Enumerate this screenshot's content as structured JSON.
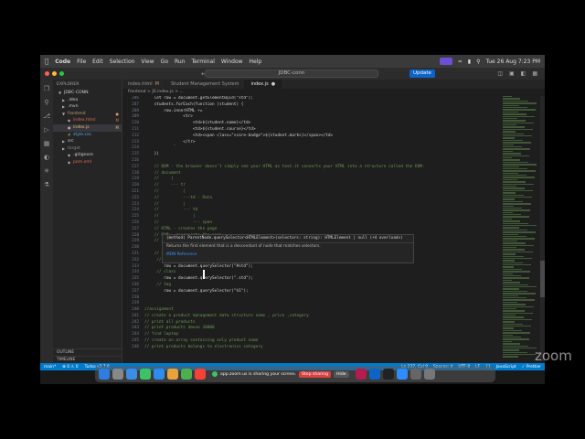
{
  "menubar": {
    "apple": "",
    "items": [
      "Code",
      "File",
      "Edit",
      "Selection",
      "View",
      "Go",
      "Run",
      "Terminal",
      "Window",
      "Help"
    ],
    "datetime": "Tue 26 Aug 7:23 PM"
  },
  "titlebar": {
    "search": "JDBC-conn",
    "update_label": "Update"
  },
  "explorer": {
    "title": "EXPLORER",
    "root": "JDBC-CONN",
    "items": [
      {
        "label": ".idea",
        "mark": ""
      },
      {
        "label": ".mvn",
        "mark": ""
      },
      {
        "label": "frontend",
        "mark": "●"
      },
      {
        "label": "index.html",
        "mark": "M"
      },
      {
        "label": "index.js",
        "mark": "M"
      },
      {
        "label": "style.css",
        "mark": ""
      },
      {
        "label": "src",
        "mark": ""
      },
      {
        "label": "target",
        "mark": ""
      },
      {
        "label": ".gitignore",
        "mark": ""
      },
      {
        "label": "pom.xml",
        "mark": ""
      }
    ],
    "outline": "OUTLINE",
    "timeline": "TIMELINE"
  },
  "tabs": [
    {
      "label": "index.html",
      "mark": "M"
    },
    {
      "label": "Student Management System",
      "mark": ""
    },
    {
      "label": "index.js",
      "mark": "●"
    }
  ],
  "breadcrumb": "frontend > JS index.js > ...",
  "code": [
    {
      "n": "206",
      "t": "    let row = document.getElementById(\"std\");",
      "c": false
    },
    {
      "n": "207",
      "t": "    students.forEach(function (student) {",
      "c": false
    },
    {
      "n": "208",
      "t": "        row.innerHTML += `",
      "c": false
    },
    {
      "n": "209",
      "t": "                <tr>",
      "c": false
    },
    {
      "n": "210",
      "t": "                    <td>${student.name}</td>",
      "c": false
    },
    {
      "n": "211",
      "t": "                    <td>${student.course}</td>",
      "c": false
    },
    {
      "n": "212",
      "t": "                    <td><span class=\"score-badge\">${student.marks}</span></td>",
      "c": false
    },
    {
      "n": "213",
      "t": "                </tr>",
      "c": false
    },
    {
      "n": "214",
      "t": "            `",
      "c": false
    },
    {
      "n": "215",
      "t": "    })",
      "c": false
    },
    {
      "n": "216",
      "t": "",
      "c": false
    },
    {
      "n": "217",
      "t": "    // DOM - the browser doesn't simply see your HTML as text.it converts your HTML into a structure called the DOM.",
      "c": true
    },
    {
      "n": "218",
      "t": "    // document",
      "c": true
    },
    {
      "n": "219",
      "t": "    //     |",
      "c": true
    },
    {
      "n": "220",
      "t": "    //     --- tr",
      "c": true
    },
    {
      "n": "221",
      "t": "    //          |",
      "c": true
    },
    {
      "n": "222",
      "t": "    //          ---td - Data",
      "c": true
    },
    {
      "n": "223",
      "t": "    //          |",
      "c": true
    },
    {
      "n": "224",
      "t": "    //          --- td",
      "c": true
    },
    {
      "n": "225",
      "t": "    //              |",
      "c": true
    },
    {
      "n": "226",
      "t": "    //              --- span",
      "c": true
    },
    {
      "n": "227",
      "t": "    // HTML - creates the page",
      "c": true
    },
    {
      "n": "228",
      "t": "    // DOM - represents the page",
      "c": true
    },
    {
      "n": "229",
      "t": "    // Javascript - mani",
      "c": true
    },
    {
      "n": "230",
      "t": "",
      "c": false
    },
    {
      "n": "231",
      "t": "    // querySelector",
      "c": true
    },
    {
      "n": "232",
      "t": "     // id",
      "c": true
    },
    {
      "n": "233",
      "t": "        row = document.querySelector(\"#std\");",
      "c": false
    },
    {
      "n": "234",
      "t": "     // class",
      "c": true
    },
    {
      "n": "235",
      "t": "        row = document.querySelector(\".std\");",
      "c": false
    },
    {
      "n": "236",
      "t": "     // tag",
      "c": true
    },
    {
      "n": "237",
      "t": "        row = document.querySelector(\"h1\");",
      "c": false
    },
    {
      "n": "238",
      "t": "",
      "c": false
    },
    {
      "n": "239",
      "t": "",
      "c": false
    },
    {
      "n": "240",
      "t": "//assignment",
      "c": true
    },
    {
      "n": "241",
      "t": "// create a product management data structure name , price ,category",
      "c": true
    },
    {
      "n": "242",
      "t": "// print all products",
      "c": true
    },
    {
      "n": "243",
      "t": "// print products above 20000",
      "c": true
    },
    {
      "n": "244",
      "t": "// find laptop",
      "c": true
    },
    {
      "n": "245",
      "t": "// create an array containing only product name",
      "c": true
    },
    {
      "n": "246",
      "t": "// print products belongs to electronics category",
      "c": true
    }
  ],
  "hover": {
    "signature": "(method) ParentNode.querySelector<HTMLElement>(selectors: string): HTMLElement | null (+4 overloads)",
    "description": "Returns the first element that is a descendant of node that matches selectors.",
    "link": "MDN Reference"
  },
  "statusbar": {
    "branch": "main*",
    "errors": "⊗ 0 ⚠ 0",
    "turbo": "Turbo v2.7.6",
    "position": "Ln 237, Col 9",
    "spaces": "Spaces: 4",
    "encoding": "UTF-8",
    "eol": "LF",
    "braces": "{}",
    "language": "JavaScript",
    "prettier": "✓ Prettier"
  },
  "dock": {
    "share_text": "app.zoom.us is sharing your screen.",
    "stop_label": "Stop sharing",
    "hide_label": "Hide"
  },
  "watermark": "zoom",
  "colors": {
    "accent": "#007acc",
    "comment": "#6a9955",
    "update": "#0e63c8"
  }
}
